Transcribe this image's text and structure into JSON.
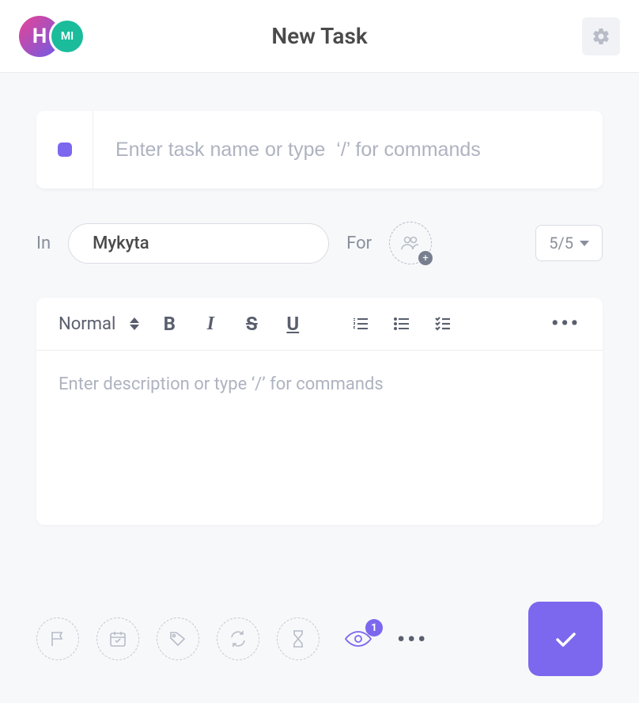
{
  "header": {
    "title": "New Task",
    "avatars": [
      {
        "label": "H",
        "color_start": "#e84393",
        "color_end": "#6c5ce7"
      },
      {
        "label": "MI",
        "color": "#1abc9c"
      }
    ]
  },
  "task": {
    "name_value": "",
    "name_placeholder": "Enter task name or type  ‘/’ for commands",
    "status_color": "#7b68ee"
  },
  "meta": {
    "in_label": "In",
    "list_selected": "Mykyta",
    "for_label": "For",
    "priority_label": "5/5"
  },
  "editor": {
    "format_label": "Normal",
    "description_placeholder": "Enter description or type ‘/’ for commands",
    "description_value": ""
  },
  "watch": {
    "count": "1"
  }
}
